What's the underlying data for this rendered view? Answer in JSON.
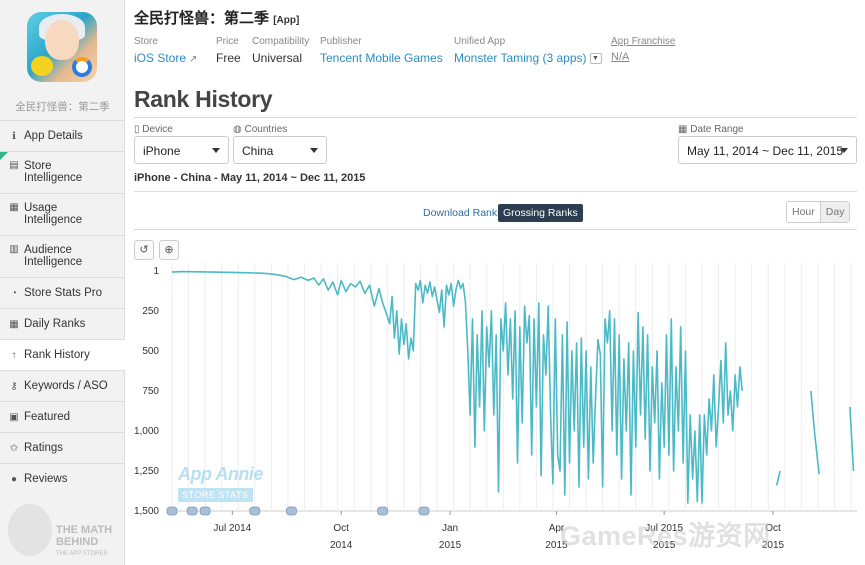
{
  "app": {
    "name_sidebar": "全民打怪兽：第二季",
    "title": "全民打怪兽：第二季",
    "title_tag": "[App]"
  },
  "meta": {
    "store_label": "Store",
    "store_value": "iOS Store",
    "price_label": "Price",
    "price_value": "Free",
    "compat_label": "Compatibility",
    "compat_value": "Universal",
    "publisher_label": "Publisher",
    "publisher_value": "Tencent Mobile Games",
    "unified_label": "Unified App",
    "unified_value": "Monster Taming (3 apps)",
    "franchise_label": "App Franchise",
    "franchise_value": "N/A"
  },
  "sidebar": {
    "items": [
      {
        "label": "App Details",
        "icon": "info-icon",
        "glyph": "ℹ"
      },
      {
        "label": "Store\nIntelligence",
        "icon": "store-icon",
        "glyph": "▤"
      },
      {
        "label": "Usage\nIntelligence",
        "icon": "usage-icon",
        "glyph": "▦"
      },
      {
        "label": "Audience\nIntelligence",
        "icon": "audience-icon",
        "glyph": "▥"
      },
      {
        "label": "Store Stats Pro",
        "icon": "gauge-icon",
        "glyph": "◔"
      },
      {
        "label": "Daily Ranks",
        "icon": "calendar-icon",
        "glyph": "▦"
      },
      {
        "label": "Rank History",
        "icon": "arrow-up-icon",
        "glyph": "↑"
      },
      {
        "label": "Keywords / ASO",
        "icon": "key-icon",
        "glyph": "⚷"
      },
      {
        "label": "Featured",
        "icon": "featured-icon",
        "glyph": "▣"
      },
      {
        "label": "Ratings",
        "icon": "star-icon",
        "glyph": "✩"
      },
      {
        "label": "Reviews",
        "icon": "comment-icon",
        "glyph": "●"
      }
    ],
    "watermark_line1": "THE MATH",
    "watermark_line2": "BEHIND",
    "watermark_line3": "THE APP STORES"
  },
  "page": {
    "title": "Rank History",
    "device_label": "Device",
    "device_value": "iPhone",
    "countries_label": "Countries",
    "countries_value": "China",
    "date_label": "Date Range",
    "date_value": "May 11, 2014 ~ Dec 11, 2015",
    "subtitle": "iPhone - China - May 11, 2014 ~ Dec 11, 2015",
    "download_tab": "Download Ranks",
    "grossing_tab": "Grossing Ranks",
    "hour_btn": "Hour",
    "day_btn": "Day",
    "watermark_title": "App Annie",
    "watermark_sub": "STORE STATS",
    "site_watermark": "GameRes游资网"
  },
  "colors": {
    "line": "#4bbac6",
    "accent_link": "#2b8fc4",
    "active_tab_bg": "#2c3e50"
  },
  "chart_data": {
    "type": "line",
    "title": "",
    "xlabel": "",
    "ylabel": "",
    "y_inverted": true,
    "ylim": [
      1,
      1500
    ],
    "yticks": [
      1,
      250,
      500,
      750,
      1000,
      1250,
      1500
    ],
    "ytick_labels": [
      "1",
      "250",
      "500",
      "750",
      "1,000",
      "1,250",
      "1,500"
    ],
    "xlim": [
      "2014-05-11",
      "2015-12-11"
    ],
    "xticks": [
      {
        "date": "2014-07-01",
        "label": "Jul 2014",
        "sub": ""
      },
      {
        "date": "2014-10-01",
        "label": "Oct",
        "sub": "2014"
      },
      {
        "date": "2015-01-01",
        "label": "Jan",
        "sub": "2015"
      },
      {
        "date": "2015-04-01",
        "label": "Apr",
        "sub": "2015"
      },
      {
        "date": "2015-07-01",
        "label": "Jul 2015",
        "sub": "2015"
      },
      {
        "date": "2015-10-01",
        "label": "Oct",
        "sub": "2015"
      }
    ],
    "grid": "vertical",
    "event_markers": [
      "2014-05-11",
      "2014-05-28",
      "2014-06-08",
      "2014-07-20",
      "2014-08-20",
      "2014-11-05",
      "2014-12-10"
    ],
    "series": [
      {
        "segments": [
          [
            [
              "2014-05-11",
              8
            ],
            [
              "2014-05-20",
              5
            ],
            [
              "2014-06-01",
              6
            ],
            [
              "2014-06-15",
              8
            ],
            [
              "2014-07-01",
              10
            ],
            [
              "2014-07-15",
              12
            ],
            [
              "2014-07-25",
              15
            ],
            [
              "2014-08-01",
              18
            ],
            [
              "2014-08-08",
              25
            ],
            [
              "2014-08-15",
              35
            ],
            [
              "2014-08-22",
              55
            ],
            [
              "2014-08-28",
              40
            ],
            [
              "2014-09-03",
              60
            ],
            [
              "2014-09-08",
              45
            ],
            [
              "2014-09-12",
              90
            ],
            [
              "2014-09-16",
              50
            ],
            [
              "2014-09-20",
              120
            ],
            [
              "2014-09-24",
              70
            ],
            [
              "2014-09-28",
              150
            ],
            [
              "2014-10-01",
              60
            ],
            [
              "2014-10-05",
              130
            ],
            [
              "2014-10-09",
              80
            ],
            [
              "2014-10-13",
              100
            ],
            [
              "2014-10-17",
              65
            ],
            [
              "2014-10-21",
              140
            ],
            [
              "2014-10-25",
              90
            ],
            [
              "2014-10-29",
              220
            ],
            [
              "2014-11-02",
              110
            ],
            [
              "2014-11-05",
              200
            ],
            [
              "2014-11-08",
              260
            ],
            [
              "2014-11-11",
              330
            ],
            [
              "2014-11-13",
              160
            ],
            [
              "2014-11-15",
              420
            ],
            [
              "2014-11-17",
              250
            ],
            [
              "2014-11-19",
              520
            ],
            [
              "2014-11-21",
              300
            ],
            [
              "2014-11-23",
              460
            ],
            [
              "2014-11-25",
              330
            ],
            [
              "2014-11-27",
              550
            ],
            [
              "2014-11-29",
              420
            ],
            [
              "2014-12-01",
              500
            ],
            [
              "2014-12-03",
              80
            ],
            [
              "2014-12-05",
              120
            ],
            [
              "2014-12-07",
              60
            ],
            [
              "2014-12-09",
              200
            ],
            [
              "2014-12-11",
              90
            ],
            [
              "2014-12-13",
              140
            ],
            [
              "2014-12-15",
              70
            ],
            [
              "2014-12-17",
              160
            ],
            [
              "2014-12-19",
              100
            ],
            [
              "2014-12-21",
              180
            ],
            [
              "2014-12-23",
              260
            ],
            [
              "2014-12-25",
              120
            ],
            [
              "2014-12-27",
              350
            ],
            [
              "2014-12-29",
              90
            ],
            [
              "2014-12-31",
              150
            ],
            [
              "2015-01-02",
              80
            ],
            [
              "2015-01-04",
              220
            ],
            [
              "2015-01-06",
              120
            ],
            [
              "2015-01-08",
              60
            ],
            [
              "2015-01-10",
              110
            ],
            [
              "2015-01-12",
              80
            ],
            [
              "2015-01-14",
              190
            ],
            [
              "2015-01-16",
              500
            ],
            [
              "2015-01-18",
              900
            ],
            [
              "2015-01-20",
              300
            ],
            [
              "2015-01-22",
              1100
            ],
            [
              "2015-01-24",
              400
            ],
            [
              "2015-01-26",
              850
            ],
            [
              "2015-01-28",
              250
            ],
            [
              "2015-01-30",
              1000
            ],
            [
              "2015-02-01",
              350
            ],
            [
              "2015-02-03",
              600
            ],
            [
              "2015-02-05",
              250
            ],
            [
              "2015-02-07",
              900
            ],
            [
              "2015-02-09",
              400
            ],
            [
              "2015-02-11",
              1380
            ],
            [
              "2015-02-13",
              300
            ],
            [
              "2015-02-15",
              500
            ],
            [
              "2015-02-17",
              200
            ],
            [
              "2015-02-19",
              650
            ],
            [
              "2015-02-21",
              300
            ],
            [
              "2015-02-23",
              800
            ],
            [
              "2015-02-25",
              250
            ],
            [
              "2015-02-27",
              1200
            ],
            [
              "2015-03-01",
              350
            ],
            [
              "2015-03-03",
              950
            ],
            [
              "2015-03-05",
              220
            ],
            [
              "2015-03-07",
              450
            ],
            [
              "2015-03-09",
              280
            ],
            [
              "2015-03-11",
              1150
            ],
            [
              "2015-03-13",
              300
            ],
            [
              "2015-03-15",
              850
            ],
            [
              "2015-03-17",
              200
            ],
            [
              "2015-03-19",
              1280
            ],
            [
              "2015-03-21",
              400
            ],
            [
              "2015-03-23",
              650
            ],
            [
              "2015-03-25",
              220
            ],
            [
              "2015-03-27",
              900
            ],
            [
              "2015-03-29",
              1330
            ],
            [
              "2015-03-31",
              300
            ],
            [
              "2015-04-02",
              1150
            ],
            [
              "2015-04-04",
              1250
            ],
            [
              "2015-04-06",
              400
            ],
            [
              "2015-04-08",
              1400
            ],
            [
              "2015-04-10",
              320
            ],
            [
              "2015-04-12",
              1200
            ],
            [
              "2015-04-14",
              500
            ],
            [
              "2015-04-16",
              1000
            ],
            [
              "2015-04-18",
              450
            ],
            [
              "2015-04-20",
              1350
            ],
            [
              "2015-04-22",
              420
            ],
            [
              "2015-04-24",
              1100
            ],
            [
              "2015-04-26",
              500
            ],
            [
              "2015-04-28",
              1300
            ],
            [
              "2015-04-30",
              600
            ],
            [
              "2015-05-02",
              1200
            ],
            [
              "2015-05-04",
              800
            ],
            [
              "2015-05-06",
              430
            ],
            [
              "2015-05-08",
              520
            ],
            [
              "2015-05-10",
              1350
            ],
            [
              "2015-05-12",
              300
            ],
            [
              "2015-05-14",
              450
            ],
            [
              "2015-05-16",
              250
            ],
            [
              "2015-05-18",
              1000
            ],
            [
              "2015-05-20",
              300
            ],
            [
              "2015-05-22",
              1150
            ],
            [
              "2015-05-24",
              400
            ],
            [
              "2015-05-26",
              1300
            ],
            [
              "2015-05-28",
              550
            ],
            [
              "2015-05-30",
              1000
            ],
            [
              "2015-06-01",
              450
            ],
            [
              "2015-06-03",
              1400
            ],
            [
              "2015-06-05",
              500
            ],
            [
              "2015-06-07",
              1100
            ],
            [
              "2015-06-09",
              260
            ],
            [
              "2015-06-11",
              900
            ],
            [
              "2015-06-13",
              350
            ],
            [
              "2015-06-15",
              1050
            ],
            [
              "2015-06-17",
              400
            ],
            [
              "2015-06-19",
              1250
            ],
            [
              "2015-06-21",
              600
            ],
            [
              "2015-06-23",
              950
            ],
            [
              "2015-06-25",
              500
            ],
            [
              "2015-06-27",
              1300
            ],
            [
              "2015-06-29",
              700
            ],
            [
              "2015-07-01",
              1100
            ],
            [
              "2015-07-03",
              400
            ],
            [
              "2015-07-05",
              1150
            ],
            [
              "2015-07-07",
              300
            ],
            [
              "2015-07-09",
              1250
            ],
            [
              "2015-07-11",
              600
            ],
            [
              "2015-07-13",
              1000
            ],
            [
              "2015-07-15",
              350
            ],
            [
              "2015-07-17",
              1200
            ],
            [
              "2015-07-19",
              500
            ],
            [
              "2015-07-21",
              1450
            ],
            [
              "2015-07-23",
              900
            ],
            [
              "2015-07-25",
              1300
            ],
            [
              "2015-07-27",
              1000
            ],
            [
              "2015-07-29",
              1440
            ],
            [
              "2015-07-31",
              900
            ],
            [
              "2015-08-02",
              1450
            ],
            [
              "2015-08-04",
              900
            ],
            [
              "2015-08-06",
              1150
            ],
            [
              "2015-08-08",
              800
            ],
            [
              "2015-08-10",
              1000
            ],
            [
              "2015-08-12",
              650
            ],
            [
              "2015-08-14",
              1100
            ],
            [
              "2015-08-16",
              850
            ],
            [
              "2015-08-18",
              560
            ],
            [
              "2015-08-20",
              950
            ],
            [
              "2015-08-22",
              450
            ],
            [
              "2015-08-24",
              900
            ],
            [
              "2015-08-26",
              750
            ],
            [
              "2015-08-28",
              1000
            ],
            [
              "2015-08-30",
              650
            ],
            [
              "2015-09-01",
              850
            ],
            [
              "2015-09-03",
              600
            ],
            [
              "2015-09-05",
              750
            ]
          ],
          [
            [
              "2015-10-04",
              1340
            ],
            [
              "2015-10-07",
              1250
            ]
          ],
          [
            [
              "2015-11-02",
              750
            ],
            [
              "2015-11-05",
              1000
            ],
            [
              "2015-11-09",
              1270
            ]
          ],
          [
            [
              "2015-12-05",
              850
            ],
            [
              "2015-12-08",
              1250
            ]
          ]
        ]
      }
    ]
  }
}
